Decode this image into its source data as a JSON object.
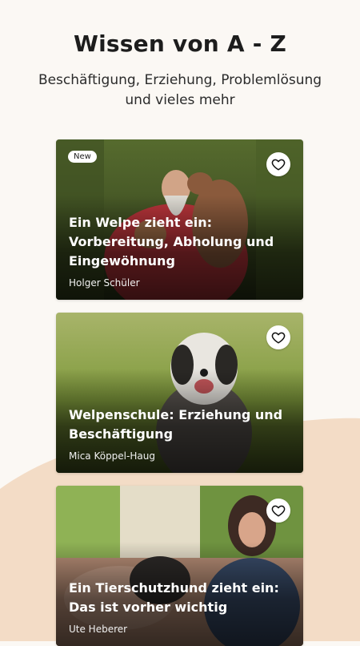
{
  "header": {
    "title": "Wissen von A - Z",
    "subtitle": "Beschäftigung, Erziehung, Problemlösung und vieles mehr"
  },
  "cards": [
    {
      "badge": "New",
      "title": "Ein Welpe zieht ein: Vorbereitung, Abholung und Eingewöhnung",
      "author": "Holger Schüler"
    },
    {
      "title": "Welpenschule: Erziehung und Beschäftigung",
      "author": "Mica Köppel-Haug"
    },
    {
      "title": "Ein Tierschutzhund zieht ein: Das ist vorher wichtig",
      "author": "Ute Heberer"
    }
  ],
  "colors": {
    "background": "#fbf8f4",
    "accent_wave": "#f3dcc6"
  },
  "icons": [
    "heart-outline-icon"
  ]
}
